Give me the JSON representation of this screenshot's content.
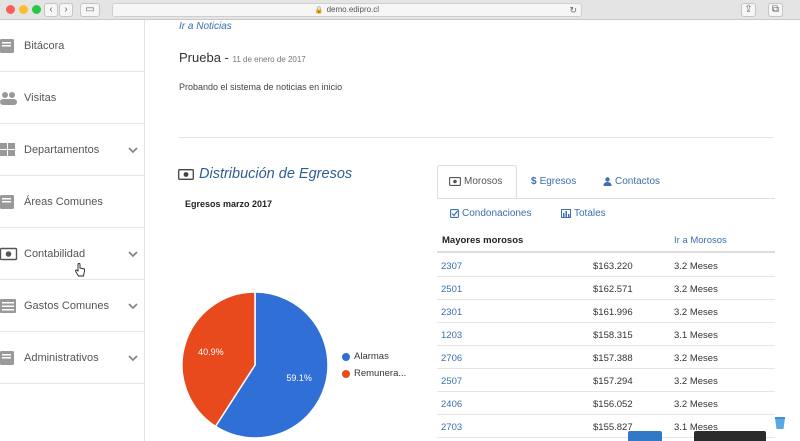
{
  "browser": {
    "url": "demo.edipro.cl"
  },
  "sidebar": {
    "items": [
      {
        "label": "Bitácora",
        "icon": "book-icon",
        "has_chevron": false
      },
      {
        "label": "Visitas",
        "icon": "users-icon",
        "has_chevron": false
      },
      {
        "label": "Departamentos",
        "icon": "grid-icon",
        "has_chevron": true
      },
      {
        "label": "Áreas Comunes",
        "icon": "book-icon",
        "has_chevron": false
      },
      {
        "label": "Contabilidad",
        "icon": "money-icon",
        "has_chevron": true
      },
      {
        "label": "Gastos Comunes",
        "icon": "list-icon",
        "has_chevron": true
      },
      {
        "label": "Administrativos",
        "icon": "book-icon",
        "has_chevron": true
      }
    ]
  },
  "news": {
    "link": "Ir a Noticias",
    "title": "Prueba -",
    "date": "11 de enero de 2017",
    "body": "Probando el sistema de noticias en inicio"
  },
  "distribution": {
    "title": "Distribución de Egresos",
    "icon": "money-icon"
  },
  "chart_data": {
    "type": "pie",
    "title": "Egresos marzo 2017",
    "series": [
      {
        "name": "Alarmas",
        "value": 59.1,
        "color": "#2f6fd6",
        "label": "59.1%"
      },
      {
        "name": "Remunera...",
        "value": 40.9,
        "color": "#e8491d",
        "label": "40.9%"
      }
    ],
    "legend_position": "right"
  },
  "tabs": [
    {
      "label": "Morosos",
      "icon": "money-icon",
      "active": true
    },
    {
      "label": "Egresos",
      "icon": "dollar-icon",
      "active": false
    },
    {
      "label": "Contactos",
      "icon": "user-icon",
      "active": false
    },
    {
      "label": "Condonaciones",
      "icon": "check-square-icon",
      "active": false
    },
    {
      "label": "Totales",
      "icon": "bar-chart-icon",
      "active": false
    }
  ],
  "table": {
    "header_label": "Mayores morosos",
    "header_link": "Ir a Morosos",
    "rows": [
      {
        "unit": "2307",
        "amount": "$163.220",
        "months": "3.2 Meses"
      },
      {
        "unit": "2501",
        "amount": "$162.571",
        "months": "3.2 Meses"
      },
      {
        "unit": "2301",
        "amount": "$161.996",
        "months": "3.2 Meses"
      },
      {
        "unit": "1203",
        "amount": "$158.315",
        "months": "3.1 Meses"
      },
      {
        "unit": "2706",
        "amount": "$157.388",
        "months": "3.2 Meses"
      },
      {
        "unit": "2507",
        "amount": "$157.294",
        "months": "3.2 Meses"
      },
      {
        "unit": "2406",
        "amount": "$156.052",
        "months": "3.2 Meses"
      },
      {
        "unit": "2703",
        "amount": "$155.827",
        "months": "3.1 Meses"
      }
    ]
  },
  "colors": {
    "link": "#3a6fb0",
    "title": "#2e5d95",
    "pie_blue": "#2f6fd6",
    "pie_orange": "#e8491d"
  }
}
